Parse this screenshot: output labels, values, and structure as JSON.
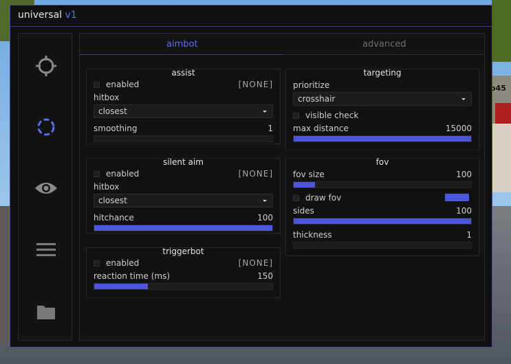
{
  "window": {
    "title": "universal",
    "version": "v1"
  },
  "background": {
    "player_tag": "o45"
  },
  "sidebar": {
    "items": [
      {
        "icon": "crosshair-icon"
      },
      {
        "icon": "loading-circle-icon",
        "active": true
      },
      {
        "icon": "eye-icon"
      },
      {
        "icon": "menu-icon"
      },
      {
        "icon": "folder-icon"
      }
    ]
  },
  "tabs": [
    {
      "label": "aimbot",
      "active": true
    },
    {
      "label": "advanced",
      "active": false
    }
  ],
  "colors": {
    "accent": "#5b6cf0",
    "fill": "#4b56d8"
  },
  "assist": {
    "title": "assist",
    "enabled_label": "enabled",
    "enabled": false,
    "keybind": "[NONE]",
    "hitbox_label": "hitbox",
    "hitbox_value": "closest",
    "smoothing_label": "smoothing",
    "smoothing_value": "1",
    "smoothing_fraction": 0
  },
  "silent_aim": {
    "title": "silent aim",
    "enabled_label": "enabled",
    "enabled": false,
    "keybind": "[NONE]",
    "hitbox_label": "hitbox",
    "hitbox_value": "closest",
    "hitchance_label": "hitchance",
    "hitchance_value": "100",
    "hitchance_fraction": 1
  },
  "triggerbot": {
    "title": "triggerbot",
    "enabled_label": "enabled",
    "enabled": false,
    "keybind": "[NONE]",
    "reaction_label": "reaction time (ms)",
    "reaction_value": "150",
    "reaction_fraction": 0.3
  },
  "targeting": {
    "title": "targeting",
    "prioritize_label": "prioritize",
    "prioritize_value": "crosshair",
    "visible_check_label": "visible check",
    "visible_check": false,
    "max_distance_label": "max distance",
    "max_distance_value": "15000",
    "max_distance_fraction": 1
  },
  "fov": {
    "title": "fov",
    "fov_size_label": "fov size",
    "fov_size_value": "100",
    "fov_size_fraction": 0.12,
    "draw_fov_label": "draw fov",
    "draw_fov": false,
    "sides_label": "sides",
    "sides_value": "100",
    "sides_fraction": 1,
    "thickness_label": "thickness",
    "thickness_value": "1",
    "thickness_fraction": 0
  }
}
